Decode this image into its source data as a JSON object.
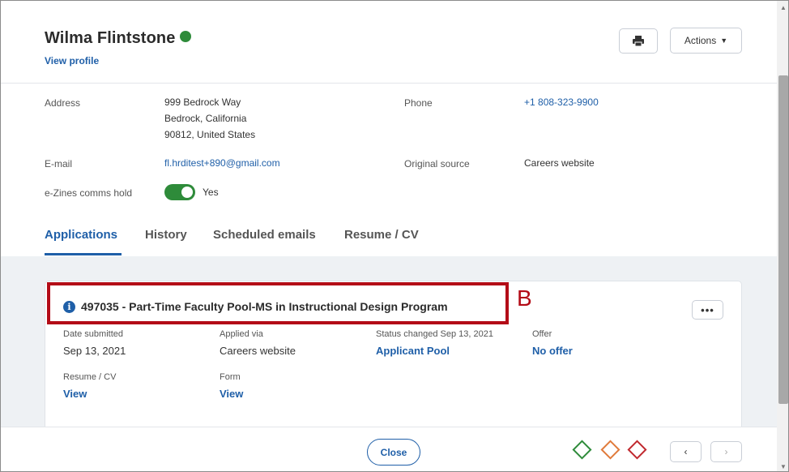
{
  "candidate": {
    "name": "Wilma Flintstone",
    "view_profile": "View profile"
  },
  "header": {
    "print_icon": "printer-icon",
    "actions_label": "Actions",
    "actions_chevron": "⌄"
  },
  "details": {
    "address_label": "Address",
    "address_line1": "999 Bedrock Way",
    "address_line2": "Bedrock, California",
    "address_line3": "90812, United States",
    "phone_label": "Phone",
    "phone_value": "+1 808-323-9900",
    "email_label": "E-mail",
    "email_value": "fl.hrditest+890@gmail.com",
    "source_label": "Original source",
    "source_value": "Careers website",
    "ezines_label": "e-Zines comms hold",
    "ezines_value": "Yes",
    "ezines_on": true
  },
  "tabs": [
    {
      "label": "Applications",
      "active": true
    },
    {
      "label": "History",
      "active": false
    },
    {
      "label": "Scheduled emails",
      "active": false
    },
    {
      "label": "Resume / CV",
      "active": false
    }
  ],
  "application": {
    "title": "497035 - Part-Time Faculty Pool-MS in Instructional Design Program",
    "more_label": "•••",
    "date_submitted_label": "Date submitted",
    "date_submitted_value": "Sep 13, 2021",
    "applied_via_label": "Applied via",
    "applied_via_value": "Careers website",
    "status_label": "Status changed Sep 13, 2021",
    "status_value": "Applicant Pool",
    "offer_label": "Offer",
    "offer_value": "No offer",
    "resume_label": "Resume / CV",
    "resume_value": "View",
    "form_label": "Form",
    "form_value": "View"
  },
  "annotation": {
    "letter": "B",
    "color": "#b30c17"
  },
  "footer": {
    "close_label": "Close",
    "prev_label": "‹",
    "next_label": "›",
    "diamond_colors": [
      "#2e8b3a",
      "#e07a3a",
      "#c0282e"
    ]
  }
}
